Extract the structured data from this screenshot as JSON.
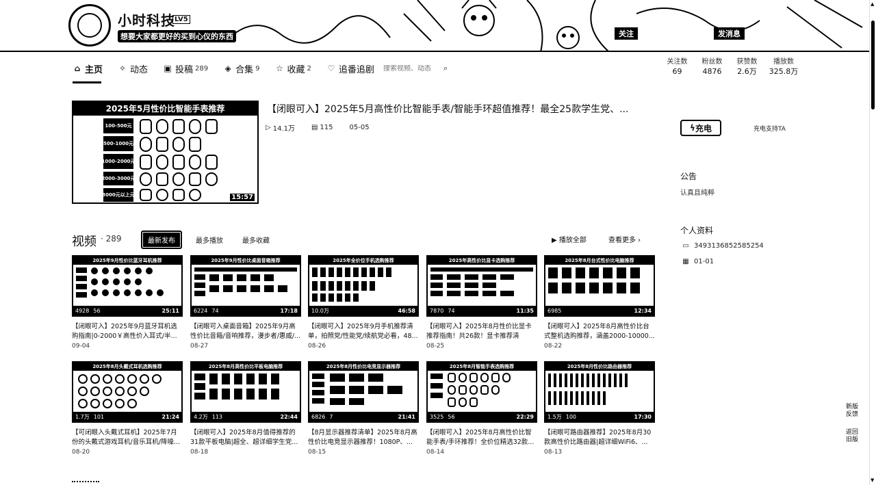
{
  "profile": {
    "name": "小时科技",
    "level": "LV5",
    "sign": "想要大家都更好的买到心仪的东西",
    "follow_label": "关注",
    "message_label": "发消息"
  },
  "nav": [
    {
      "label": "主页",
      "count": "",
      "icon": "home-icon"
    },
    {
      "label": "动态",
      "count": "",
      "icon": "dynamic-icon"
    },
    {
      "label": "投稿",
      "count": "289",
      "icon": "upload-icon"
    },
    {
      "label": "合集",
      "count": "9",
      "icon": "collection-icon"
    },
    {
      "label": "收藏",
      "count": "2",
      "icon": "star-icon"
    },
    {
      "label": "追番追剧",
      "count": "",
      "icon": "heart-icon"
    }
  ],
  "search": {
    "placeholder": "搜索视频、动态"
  },
  "stats": [
    {
      "label": "关注数",
      "value": "69"
    },
    {
      "label": "粉丝数",
      "value": "4876"
    },
    {
      "label": "获赞数",
      "value": "2.6万"
    },
    {
      "label": "播放数",
      "value": "325.8万"
    }
  ],
  "featured": {
    "thumb_title": "2025年5月性价比智能手表推荐",
    "price_tags": [
      "100-500元",
      "500-1000元",
      "1000-2000元",
      "2000-3000元",
      "3000元以上元"
    ],
    "duration": "15:57",
    "title": "【闭眼可入】2025年5月高性价比智能手表/智能手环超值推荐！最全25款学生党、...",
    "plays": "14.1万",
    "comments": "115",
    "date": "05-05"
  },
  "sidebar": {
    "charge_label": "充电",
    "charge_support": "充电支持TA",
    "notice_title": "公告",
    "notice_text": "认真且纯粹",
    "profile_title": "个人资料",
    "uid": "3493136852585254",
    "birthday": "01-01"
  },
  "videos_section": {
    "title": "视频",
    "count": "289",
    "sort_tabs": [
      "最新发布",
      "最多播放",
      "最多收藏"
    ],
    "play_all": "▶ 播放全部",
    "see_more": "查看更多 ›"
  },
  "videos": [
    {
      "thumb": "2025年9月性价比蓝牙耳机推荐",
      "plays": "4928",
      "comments": "56",
      "duration": "25:11",
      "title": "【闭眼可入】2025年9月蓝牙耳机选购指南|0-2000￥高性价入耳式/半...",
      "date": "09-04"
    },
    {
      "thumb": "2025年9月性价比桌面音箱推荐",
      "plays": "6224",
      "comments": "74",
      "duration": "17:18",
      "title": "【闭眼可入桌面音箱】2025年9月高性价比音箱/音响推荐，漫步者/惠威/...",
      "date": "08-27"
    },
    {
      "thumb": "2025年全价位手机选购推荐",
      "plays": "10.0万",
      "comments": "",
      "duration": "46:58",
      "title": "【闭眼可入】2025年9月手机推荐清单，拍照党/性能党/续航党必看，48...",
      "date": "08-26"
    },
    {
      "thumb": "2025年高性价比显卡选购推荐",
      "plays": "7870",
      "comments": "74",
      "duration": "11:35",
      "title": "【闭眼可入】2025年8月性价比显卡推荐指南！共26款！显卡推荐清单！...",
      "date": "08-25"
    },
    {
      "thumb": "2025年8月台式性价比电脑推荐",
      "plays": "6985",
      "comments": "",
      "duration": "12:34",
      "title": "【闭眼可入】2025年8月高性价比台式整机选购推荐，涵盖2000-10000...",
      "date": "08-22"
    },
    {
      "thumb": "2025年8月头戴式耳机选购推荐",
      "plays": "1.7万",
      "comments": "101",
      "duration": "21:24",
      "title": "【可闭眼入头戴式耳机】2025年7月份的头戴式游戏耳机/音乐耳机/降噪...",
      "date": "08-20"
    },
    {
      "thumb": "2025年8月高性价比平板电脑推荐",
      "plays": "4.2万",
      "comments": "113",
      "duration": "22:44",
      "title": "【闭眼可入】2025年8月值得推荐的31款平板电脑|超全、超详细学生党...",
      "date": "08-18"
    },
    {
      "thumb": "2025年8月性价比电竞显示器推荐",
      "plays": "6826",
      "comments": "7",
      "duration": "21:41",
      "title": "【8月显示器推荐清单】2025年8月高性价比电竞显示器推荐！1080P、...",
      "date": "08-15"
    },
    {
      "thumb": "2025年8月智能手表选购推荐",
      "plays": "3525",
      "comments": "56",
      "duration": "22:29",
      "title": "【闭眼可入】2025年8月高性价比智能手表/手环推荐！全价位精选32款...",
      "date": "08-14"
    },
    {
      "thumb": "2025年8月性价比路由器推荐",
      "plays": "1.5万",
      "comments": "100",
      "duration": "17:30",
      "title": "【闭眼可路由器推荐】2025年8月30款高性价比路由器|超详细WiFi6、...",
      "date": "08-13"
    }
  ],
  "side_buttons": {
    "feedback": "新版反馈",
    "old": "返回旧版"
  }
}
